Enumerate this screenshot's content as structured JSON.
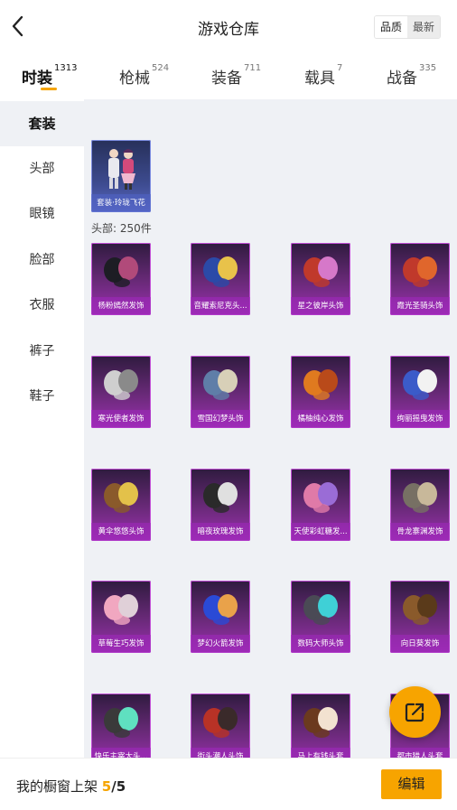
{
  "header": {
    "title": "游戏仓库",
    "sort_options": [
      "品质",
      "最新"
    ],
    "sort_selected": "品质"
  },
  "tabs": [
    {
      "label": "时装",
      "count": "1313",
      "active": true
    },
    {
      "label": "枪械",
      "count": "524",
      "active": false
    },
    {
      "label": "装备",
      "count": "711",
      "active": false
    },
    {
      "label": "载具",
      "count": "7",
      "active": false
    },
    {
      "label": "战备",
      "count": "335",
      "active": false
    }
  ],
  "sidebar": {
    "items": [
      {
        "label": "套装",
        "active": true
      },
      {
        "label": "头部",
        "active": false
      },
      {
        "label": "眼镜",
        "active": false
      },
      {
        "label": "脸部",
        "active": false
      },
      {
        "label": "衣服",
        "active": false
      },
      {
        "label": "裤子",
        "active": false
      },
      {
        "label": "鞋子",
        "active": false
      }
    ]
  },
  "suit_item": {
    "label": "套装·玲珑飞花",
    "icon": "suit-outfit-icon"
  },
  "section": {
    "label": "头部: 250件"
  },
  "items": [
    {
      "label": "杨粉嫣然发饰",
      "icon": "hair-accessory-icon"
    },
    {
      "label": "音耀索尼克头...",
      "icon": "sonic-headwear-icon"
    },
    {
      "label": "星之彼岸头饰",
      "icon": "star-headwear-icon"
    },
    {
      "label": "霞光圣骑头饰",
      "icon": "knight-helmet-icon"
    },
    {
      "label": "寒光使者发饰",
      "icon": "hair-accessory-icon"
    },
    {
      "label": "雪国幻梦头饰",
      "icon": "headwear-icon"
    },
    {
      "label": "橘柚纯心发饰",
      "icon": "hair-accessory-icon"
    },
    {
      "label": "绚丽摇曳发饰",
      "icon": "hair-accessory-icon"
    },
    {
      "label": "黄伞悠悠头饰",
      "icon": "umbrella-headwear-icon"
    },
    {
      "label": "暗夜玫瑰发饰",
      "icon": "rose-hair-icon"
    },
    {
      "label": "天使彩虹糖发...",
      "icon": "hair-accessory-icon"
    },
    {
      "label": "骨龙寨渊发饰",
      "icon": "hair-accessory-icon"
    },
    {
      "label": "草莓生巧发饰",
      "icon": "strawberry-hair-icon"
    },
    {
      "label": "梦幻火箭发饰",
      "icon": "rocket-hair-icon"
    },
    {
      "label": "数码大师头饰",
      "icon": "helmet-icon"
    },
    {
      "label": "向日葵发饰",
      "icon": "sunflower-hair-icon"
    },
    {
      "label": "快乐主宰大头...",
      "icon": "robot-head-icon"
    },
    {
      "label": "街头潮人头饰",
      "icon": "street-hat-icon"
    },
    {
      "label": "马上有钱头套",
      "icon": "horse-mask-icon"
    },
    {
      "label": "都市猎人头套",
      "icon": "hunter-mask-icon"
    }
  ],
  "share_button": {
    "icon": "share-external-icon"
  },
  "footer": {
    "shelf_text": "我的橱窗上架",
    "shelf_count": "5",
    "shelf_sep": "/",
    "shelf_total": "5",
    "edit_label": "编辑"
  },
  "colors": {
    "accent": "#f7a400",
    "epic_card": "#9b2fb0",
    "panel_bg": "#eff1f5"
  }
}
